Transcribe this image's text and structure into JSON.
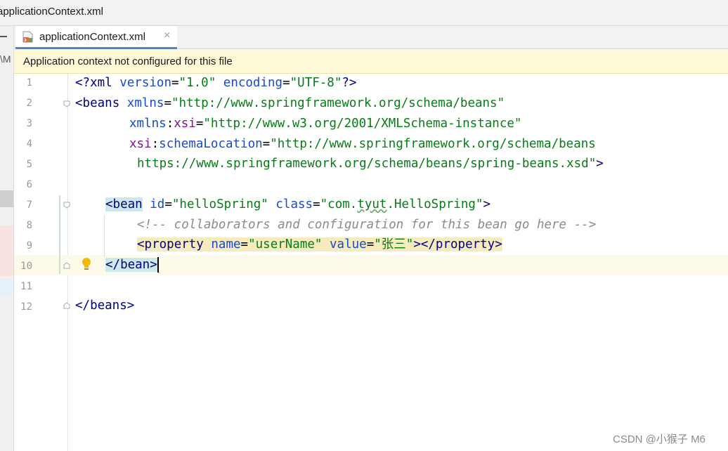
{
  "window": {
    "title": "applicationContext.xml"
  },
  "left_panel": {
    "fragment_text": "\\M"
  },
  "tab": {
    "label": "applicationContext.xml",
    "close_glyph": "×",
    "icon": "xml-file-icon"
  },
  "banner": {
    "message": "Application context not configured for this file"
  },
  "editor": {
    "line_numbers": [
      "1",
      "2",
      "3",
      "4",
      "5",
      "6",
      "7",
      "8",
      "9",
      "10",
      "11",
      "12"
    ],
    "lines": [
      {
        "tokens": [
          "<?",
          "xml",
          " ",
          "version",
          "=",
          "\"1.0\"",
          " ",
          "encoding",
          "=",
          "\"UTF-8\"",
          "?>"
        ]
      },
      {
        "tokens": [
          "<",
          "beans",
          " ",
          "xmlns",
          "=",
          "\"http://www.springframework.org/schema/beans\""
        ]
      },
      {
        "tokens": [
          "xmlns",
          ":",
          "xsi",
          "=",
          "\"http://www.w3.org/2001/XMLSchema-instance\""
        ]
      },
      {
        "tokens": [
          "xsi",
          ":",
          "schemaLocation",
          "=",
          "\"http://www.springframework.org/schema/beans"
        ]
      },
      {
        "tokens": [
          "https://www.springframework.org/schema/beans/spring-beans.xsd\"",
          ">"
        ]
      },
      {
        "tokens": []
      },
      {
        "tokens": [
          "<",
          "bean",
          " ",
          "id",
          "=",
          "\"helloSpring\"",
          " ",
          "class",
          "=",
          "\"com.",
          "tyut",
          ".HelloSpring\"",
          ">"
        ]
      },
      {
        "tokens": [
          "<!-- collaborators and configuration for this bean go here -->"
        ]
      },
      {
        "tokens": [
          "<",
          "property",
          " ",
          "name",
          "=",
          "\"userName\"",
          " ",
          "value",
          "=",
          "\"张三\"",
          "></",
          "property",
          ">"
        ]
      },
      {
        "tokens": [
          "</",
          "bean",
          ">"
        ]
      },
      {
        "tokens": []
      },
      {
        "tokens": [
          "</",
          "beans",
          ">"
        ]
      }
    ]
  },
  "watermark": {
    "text": "CSDN @小猴子 M6"
  },
  "colors": {
    "tag": "#000080",
    "attribute": "#174ad4",
    "namespace": "#871094",
    "string": "#067d17",
    "comment": "#8c8c8c",
    "banner_bg": "#fdf8d6",
    "tab_underline": "#4a88c7"
  }
}
